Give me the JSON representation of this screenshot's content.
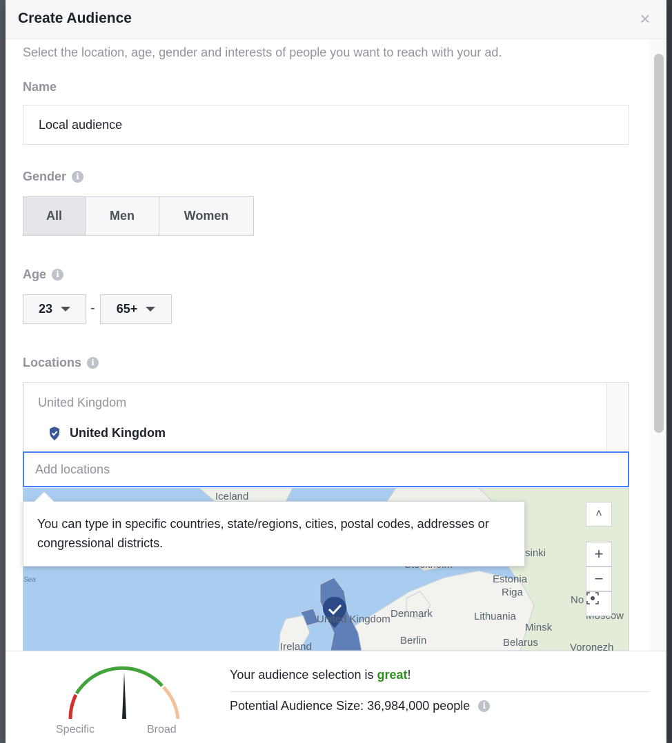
{
  "dialog": {
    "title": "Create Audience",
    "close_label": "×"
  },
  "intro": "Select the location, age, gender and interests of people you want to reach with your ad.",
  "name": {
    "label": "Name",
    "value": "Local audience"
  },
  "gender": {
    "label": "Gender",
    "options": [
      "All",
      "Men",
      "Women"
    ],
    "selected": "All"
  },
  "age": {
    "label": "Age",
    "min": "23",
    "max": "65+",
    "separator": "-"
  },
  "locations": {
    "label": "Locations",
    "group_header": "United Kingdom",
    "selected_item": "United Kingdom",
    "input_placeholder": "Add locations",
    "tooltip": "You can type in specific countries, state/regions, cities, postal codes, addresses or congressional districts."
  },
  "map": {
    "labels": {
      "iceland": "Iceland",
      "sea": "Sea",
      "stockholm": "Stockholm",
      "helsinki": "sinki",
      "estonia": "Estonia",
      "riga": "Riga",
      "denmark": "Denmark",
      "lithuania": "Lithuania",
      "norway_partial": "No",
      "moscow": "Moscow",
      "minsk": "Minsk",
      "united_kingdom": "United Kingdom",
      "ireland": "Ireland",
      "berlin": "Berlin",
      "belarus": "Belarus",
      "voronezh": "Voronezh"
    },
    "controls": {
      "collapse": "˄",
      "zoom_in": "+",
      "zoom_out": "−"
    }
  },
  "footer": {
    "verdict_prefix": "Your audience selection is ",
    "verdict_word": "great",
    "verdict_suffix": "!",
    "size_label": "Potential Audience Size: 36,984,000 people",
    "gauge": {
      "left_label": "Specific",
      "right_label": "Broad",
      "needle_fraction": 0.5
    }
  },
  "colors": {
    "accent_blue": "#4080ff",
    "pin_blue": "#3b5998",
    "great_green": "#2d8f1f",
    "gauge_red": "#d0312d",
    "gauge_green": "#42a33a",
    "gauge_peach": "#f2c39b"
  }
}
